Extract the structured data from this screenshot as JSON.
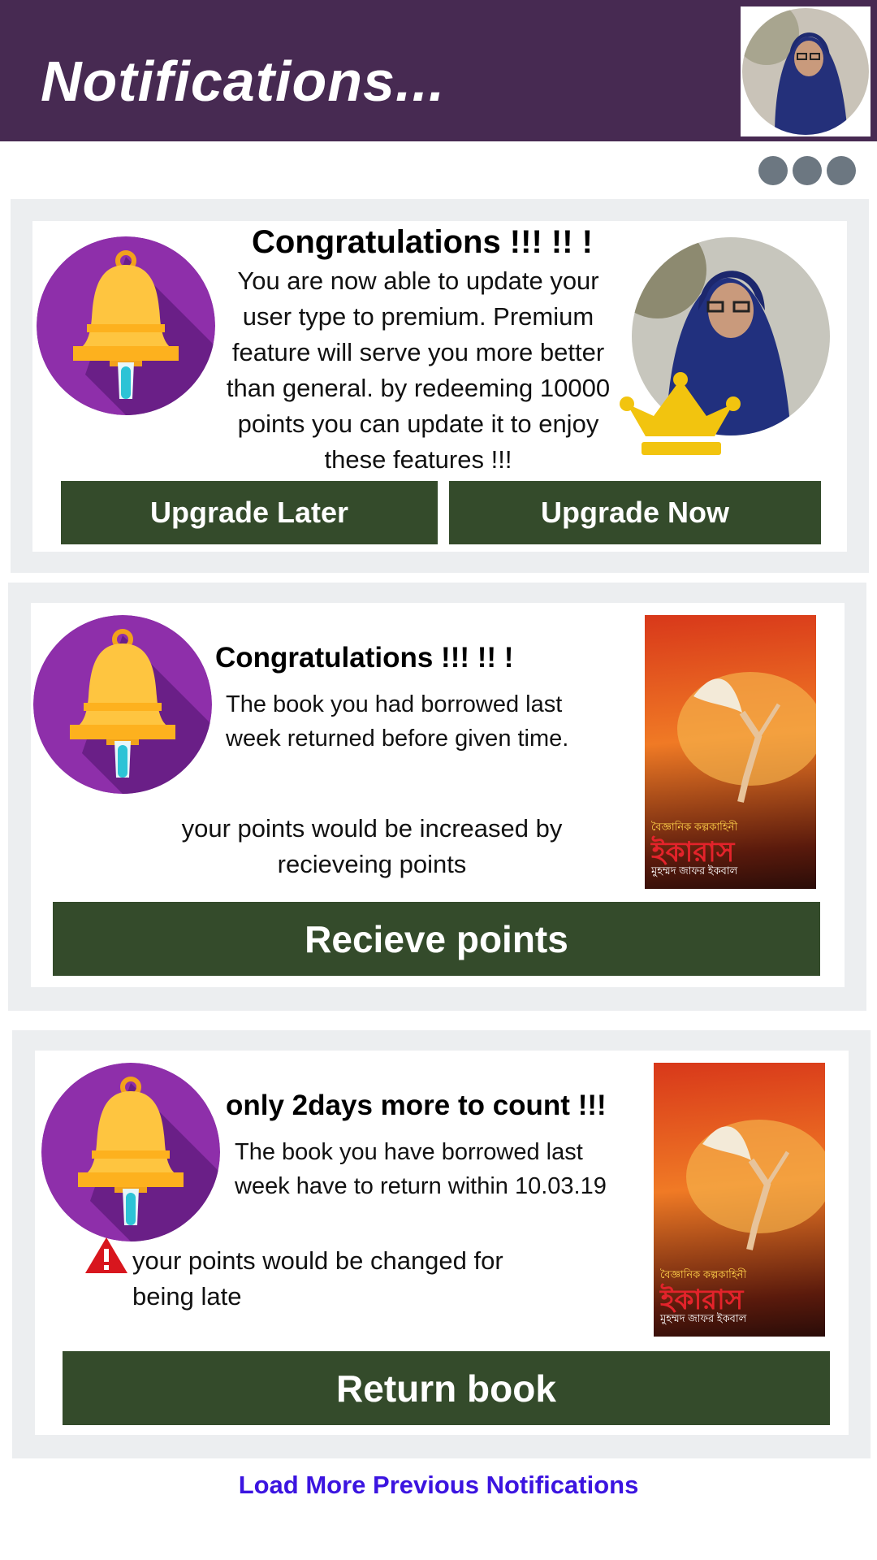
{
  "header": {
    "title": "Notifications..."
  },
  "menu": {
    "icon": "more-dots-icon"
  },
  "notifications": [
    {
      "title": "Congratulations !!! !! !",
      "body": "You are now able to update your user type to premium. Premium feature will serve you more better than general. by redeeming 10000 points you can update it to enjoy these features !!!",
      "buttons": [
        "Upgrade Later",
        "Upgrade Now"
      ]
    },
    {
      "title": "Congratulations !!! !! !",
      "body": "The book you had borrowed last week returned before given time.",
      "note": "your points would be increased by recieveing points",
      "button": "Recieve points",
      "book": {
        "series": "বৈজ্ঞানিক কল্পকাহিনী",
        "title": "ইকারাস",
        "author": "মুহম্মদ জাফর ইকবাল"
      }
    },
    {
      "title": "only 2days more to count !!!",
      "body": "The book you have borrowed last week have to return within 10.03.19",
      "note": "your points would be changed for being late",
      "button": "Return book",
      "book": {
        "series": "বৈজ্ঞানিক কল্পকাহিনী",
        "title": "ইকারাস",
        "author": "মুহম্মদ জাফর ইকবাল"
      }
    }
  ],
  "footer": {
    "load_more": "Load More Previous Notifications"
  },
  "colors": {
    "header": "#472a52",
    "button": "#344b2b",
    "link": "#3b14e0",
    "card": "#eceef0"
  }
}
